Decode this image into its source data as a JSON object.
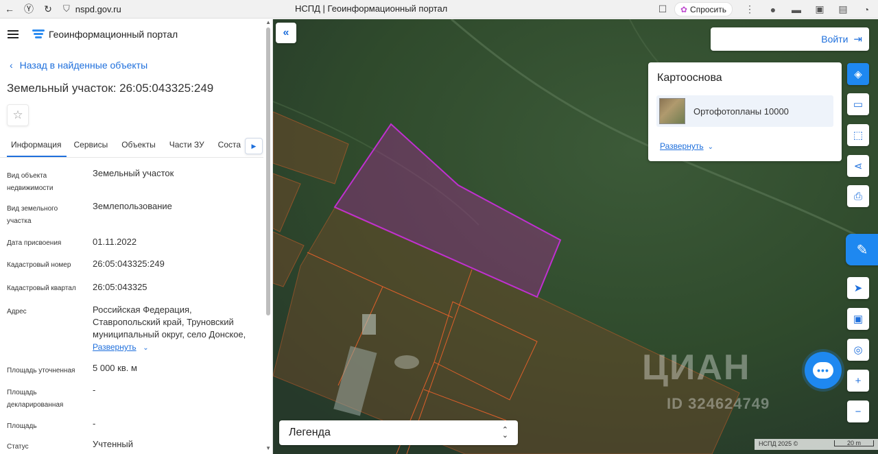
{
  "browser": {
    "url": "nspd.gov.ru",
    "title": "НСПД | Геоинформационный портал",
    "ask_label": "Спросить"
  },
  "sidebar": {
    "brand": "Геоинформационный портал",
    "back_link": "Назад в найденные объекты",
    "object_title": "Земельный участок: 26:05:043325:249",
    "tabs": [
      "Информация",
      "Сервисы",
      "Объекты",
      "Части ЗУ",
      "Соста"
    ],
    "properties": [
      {
        "key": "Вид объекта недвижимости",
        "value": "Земельный участок"
      },
      {
        "key": "Вид земельного участка",
        "value": "Землепользование"
      },
      {
        "key": "Дата присвоения",
        "value": "01.11.2022"
      },
      {
        "key": "Кадастровый номер",
        "value": "26:05:043325:249"
      },
      {
        "key": "Кадастровый квартал",
        "value": "26:05:043325"
      },
      {
        "key": "Адрес",
        "value": "Российская Федерация, Ставропольский край, Труновский муниципальный округ, село Донское,"
      },
      {
        "key": "Площадь уточненная",
        "value": "5 000 кв. м"
      },
      {
        "key": "Площадь декларированная",
        "value": "-"
      },
      {
        "key": "Площадь",
        "value": "-"
      },
      {
        "key": "Статус",
        "value": "Учтенный"
      }
    ],
    "address_expand": "Развернуть"
  },
  "map": {
    "login": "Войти",
    "basemap": {
      "title": "Картооснова",
      "layer": "Ортофотопланы 10000",
      "expand": "Развернуть"
    },
    "legend": "Легенда",
    "watermark_brand": "ЦИАН",
    "watermark_id": "ID 324624749",
    "attribution": "НСПД 2025 ©",
    "scale": "20 m",
    "colors": {
      "accent": "#1e88f0",
      "selected_parcel": "#c030d0",
      "parcel_border": "#e0602a"
    }
  }
}
